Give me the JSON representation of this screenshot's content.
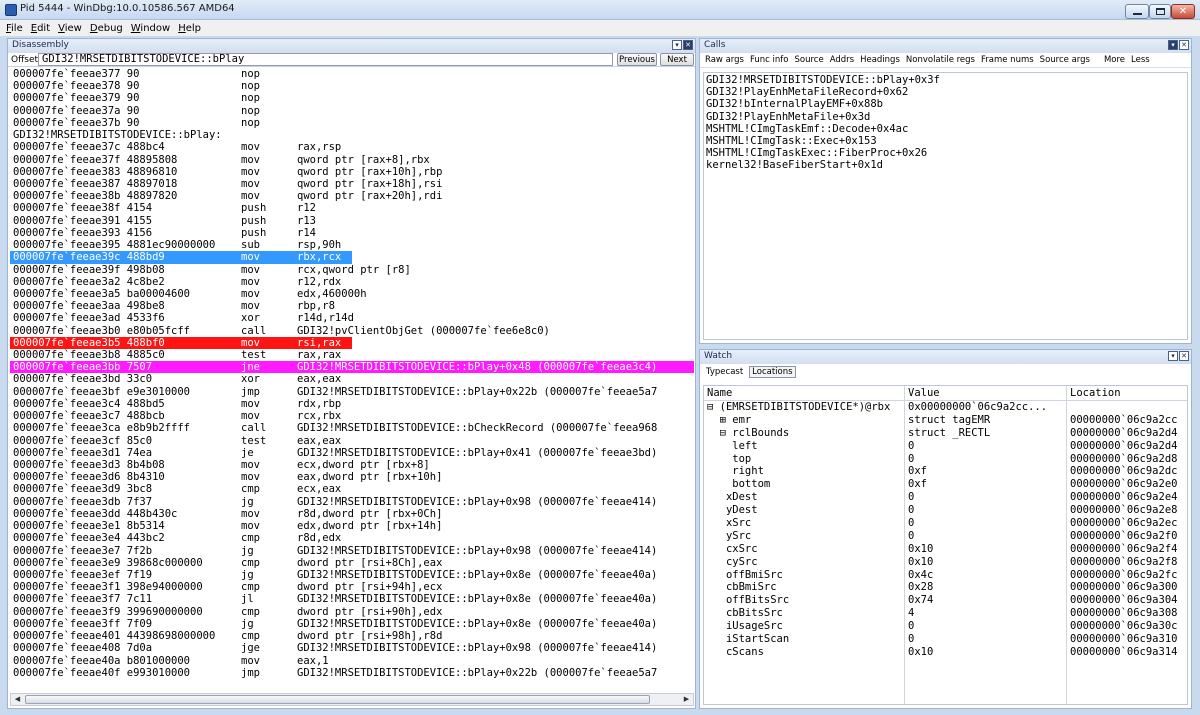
{
  "window": {
    "title": "Pid 5444 - WinDbg:10.0.10586.567 AMD64",
    "minimize": "—",
    "maximize": "□",
    "close": "✕"
  },
  "menu": [
    "File",
    "Edit",
    "View",
    "Debug",
    "Window",
    "Help"
  ],
  "disassembly": {
    "title": "Disassembly",
    "offset_label": "Offset:",
    "offset_value": "GDI32!MRSETDIBITSTODEVICE::bPlay",
    "previous": "Previous",
    "next": "Next",
    "lines": [
      {
        "addr": "000007fe`feeae377 90",
        "mn": "nop",
        "op": ""
      },
      {
        "addr": "000007fe`feeae378 90",
        "mn": "nop",
        "op": ""
      },
      {
        "addr": "000007fe`feeae379 90",
        "mn": "nop",
        "op": ""
      },
      {
        "addr": "000007fe`feeae37a 90",
        "mn": "nop",
        "op": ""
      },
      {
        "addr": "000007fe`feeae37b 90",
        "mn": "nop",
        "op": ""
      },
      {
        "label": "GDI32!MRSETDIBITSTODEVICE::bPlay:"
      },
      {
        "addr": "000007fe`feeae37c 488bc4",
        "mn": "mov",
        "op": "rax,rsp"
      },
      {
        "addr": "000007fe`feeae37f 48895808",
        "mn": "mov",
        "op": "qword ptr [rax+8],rbx"
      },
      {
        "addr": "000007fe`feeae383 48896810",
        "mn": "mov",
        "op": "qword ptr [rax+10h],rbp"
      },
      {
        "addr": "000007fe`feeae387 48897018",
        "mn": "mov",
        "op": "qword ptr [rax+18h],rsi"
      },
      {
        "addr": "000007fe`feeae38b 48897820",
        "mn": "mov",
        "op": "qword ptr [rax+20h],rdi"
      },
      {
        "addr": "000007fe`feeae38f 4154",
        "mn": "push",
        "op": "r12"
      },
      {
        "addr": "000007fe`feeae391 4155",
        "mn": "push",
        "op": "r13"
      },
      {
        "addr": "000007fe`feeae393 4156",
        "mn": "push",
        "op": "r14"
      },
      {
        "addr": "000007fe`feeae395 4881ec90000000",
        "mn": "sub",
        "op": "rsp,90h"
      },
      {
        "addr": "000007fe`feeae39c 488bd9",
        "mn": "mov",
        "op": "rbx,rcx",
        "hl": "blue"
      },
      {
        "addr": "000007fe`feeae39f 498b08",
        "mn": "mov",
        "op": "rcx,qword ptr [r8]"
      },
      {
        "addr": "000007fe`feeae3a2 4c8be2",
        "mn": "mov",
        "op": "r12,rdx"
      },
      {
        "addr": "000007fe`feeae3a5 ba00004600",
        "mn": "mov",
        "op": "edx,460000h"
      },
      {
        "addr": "000007fe`feeae3aa 498be8",
        "mn": "mov",
        "op": "rbp,r8"
      },
      {
        "addr": "000007fe`feeae3ad 4533f6",
        "mn": "xor",
        "op": "r14d,r14d"
      },
      {
        "addr": "000007fe`feeae3b0 e80b05fcff",
        "mn": "call",
        "op": "GDI32!pvClientObjGet (000007fe`fee6e8c0)"
      },
      {
        "addr": "000007fe`feeae3b5 488bf0",
        "mn": "mov",
        "op": "rsi,rax",
        "hl": "red"
      },
      {
        "addr": "000007fe`feeae3b8 4885c0",
        "mn": "test",
        "op": "rax,rax"
      },
      {
        "addr": "000007fe`feeae3bb 7507",
        "mn": "jne",
        "op": "GDI32!MRSETDIBITSTODEVICE::bPlay+0x48 (000007fe`feeae3c4)",
        "hl": "magenta"
      },
      {
        "addr": "000007fe`feeae3bd 33c0",
        "mn": "xor",
        "op": "eax,eax"
      },
      {
        "addr": "000007fe`feeae3bf e9e3010000",
        "mn": "jmp",
        "op": "GDI32!MRSETDIBITSTODEVICE::bPlay+0x22b (000007fe`feeae5a7"
      },
      {
        "addr": "000007fe`feeae3c4 488bd5",
        "mn": "mov",
        "op": "rdx,rbp"
      },
      {
        "addr": "000007fe`feeae3c7 488bcb",
        "mn": "mov",
        "op": "rcx,rbx"
      },
      {
        "addr": "000007fe`feeae3ca e8b9b2ffff",
        "mn": "call",
        "op": "GDI32!MRSETDIBITSTODEVICE::bCheckRecord (000007fe`feea968"
      },
      {
        "addr": "000007fe`feeae3cf 85c0",
        "mn": "test",
        "op": "eax,eax"
      },
      {
        "addr": "000007fe`feeae3d1 74ea",
        "mn": "je",
        "op": "GDI32!MRSETDIBITSTODEVICE::bPlay+0x41 (000007fe`feeae3bd)"
      },
      {
        "addr": "000007fe`feeae3d3 8b4b08",
        "mn": "mov",
        "op": "ecx,dword ptr [rbx+8]"
      },
      {
        "addr": "000007fe`feeae3d6 8b4310",
        "mn": "mov",
        "op": "eax,dword ptr [rbx+10h]"
      },
      {
        "addr": "000007fe`feeae3d9 3bc8",
        "mn": "cmp",
        "op": "ecx,eax"
      },
      {
        "addr": "000007fe`feeae3db 7f37",
        "mn": "jg",
        "op": "GDI32!MRSETDIBITSTODEVICE::bPlay+0x98 (000007fe`feeae414)"
      },
      {
        "addr": "000007fe`feeae3dd 448b430c",
        "mn": "mov",
        "op": "r8d,dword ptr [rbx+0Ch]"
      },
      {
        "addr": "000007fe`feeae3e1 8b5314",
        "mn": "mov",
        "op": "edx,dword ptr [rbx+14h]"
      },
      {
        "addr": "000007fe`feeae3e4 443bc2",
        "mn": "cmp",
        "op": "r8d,edx"
      },
      {
        "addr": "000007fe`feeae3e7 7f2b",
        "mn": "jg",
        "op": "GDI32!MRSETDIBITSTODEVICE::bPlay+0x98 (000007fe`feeae414)"
      },
      {
        "addr": "000007fe`feeae3e9 39868c000000",
        "mn": "cmp",
        "op": "dword ptr [rsi+8Ch],eax"
      },
      {
        "addr": "000007fe`feeae3ef 7f19",
        "mn": "jg",
        "op": "GDI32!MRSETDIBITSTODEVICE::bPlay+0x8e (000007fe`feeae40a)"
      },
      {
        "addr": "000007fe`feeae3f1 398e94000000",
        "mn": "cmp",
        "op": "dword ptr [rsi+94h],ecx"
      },
      {
        "addr": "000007fe`feeae3f7 7c11",
        "mn": "jl",
        "op": "GDI32!MRSETDIBITSTODEVICE::bPlay+0x8e (000007fe`feeae40a)"
      },
      {
        "addr": "000007fe`feeae3f9 399690000000",
        "mn": "cmp",
        "op": "dword ptr [rsi+90h],edx"
      },
      {
        "addr": "000007fe`feeae3ff 7f09",
        "mn": "jg",
        "op": "GDI32!MRSETDIBITSTODEVICE::bPlay+0x8e (000007fe`feeae40a)"
      },
      {
        "addr": "000007fe`feeae401 44398698000000",
        "mn": "cmp",
        "op": "dword ptr [rsi+98h],r8d"
      },
      {
        "addr": "000007fe`feeae408 7d0a",
        "mn": "jge",
        "op": "GDI32!MRSETDIBITSTODEVICE::bPlay+0x98 (000007fe`feeae414)"
      },
      {
        "addr": "000007fe`feeae40a b801000000",
        "mn": "mov",
        "op": "eax,1"
      },
      {
        "addr": "000007fe`feeae40f e993010000",
        "mn": "jmp",
        "op": "GDI32!MRSETDIBITSTODEVICE::bPlay+0x22b (000007fe`feeae5a7"
      }
    ],
    "scroll_grip": "⫼"
  },
  "calls": {
    "title": "Calls",
    "toolbar": [
      "Raw args",
      "Func info",
      "Source",
      "Addrs",
      "Headings",
      "Nonvolatile regs",
      "Frame nums",
      "Source args",
      "More",
      "Less"
    ],
    "frames": [
      "GDI32!MRSETDIBITSTODEVICE::bPlay+0x3f",
      "GDI32!PlayEnhMetaFileRecord+0x62",
      "GDI32!bInternalPlayEMF+0x88b",
      "GDI32!PlayEnhMetaFile+0x3d",
      "MSHTML!CImgTaskEmf::Decode+0x4ac",
      "MSHTML!CImgTask::Exec+0x153",
      "MSHTML!CImgTaskExec::FiberProc+0x26",
      "kernel32!BaseFiberStart+0x1d"
    ]
  },
  "watch": {
    "title": "Watch",
    "tabs": [
      "Typecast",
      "Locations"
    ],
    "headers": {
      "name": "Name",
      "value": "Value",
      "location": "Location"
    },
    "rows": [
      {
        "name": "⊟ (EMRSETDIBITSTODEVICE*)@rbx",
        "value": "0x00000000`06c9a2cc...",
        "location": ""
      },
      {
        "name": "  ⊞ emr",
        "value": "struct tagEMR",
        "location": "00000000`06c9a2cc"
      },
      {
        "name": "  ⊟ rclBounds",
        "value": "struct _RECTL",
        "location": "00000000`06c9a2d4"
      },
      {
        "name": "    left",
        "value": "0",
        "location": "00000000`06c9a2d4"
      },
      {
        "name": "    top",
        "value": "0",
        "location": "00000000`06c9a2d8"
      },
      {
        "name": "    right",
        "value": "0xf",
        "location": "00000000`06c9a2dc"
      },
      {
        "name": "    bottom",
        "value": "0xf",
        "location": "00000000`06c9a2e0"
      },
      {
        "name": "   xDest",
        "value": "0",
        "location": "00000000`06c9a2e4"
      },
      {
        "name": "   yDest",
        "value": "0",
        "location": "00000000`06c9a2e8"
      },
      {
        "name": "   xSrc",
        "value": "0",
        "location": "00000000`06c9a2ec"
      },
      {
        "name": "   ySrc",
        "value": "0",
        "location": "00000000`06c9a2f0"
      },
      {
        "name": "   cxSrc",
        "value": "0x10",
        "location": "00000000`06c9a2f4"
      },
      {
        "name": "   cySrc",
        "value": "0x10",
        "location": "00000000`06c9a2f8"
      },
      {
        "name": "   offBmiSrc",
        "value": "0x4c",
        "location": "00000000`06c9a2fc"
      },
      {
        "name": "   cbBmiSrc",
        "value": "0x28",
        "location": "00000000`06c9a300"
      },
      {
        "name": "   offBitsSrc",
        "value": "0x74",
        "location": "00000000`06c9a304"
      },
      {
        "name": "   cbBitsSrc",
        "value": "4",
        "location": "00000000`06c9a308"
      },
      {
        "name": "   iUsageSrc",
        "value": "0",
        "location": "00000000`06c9a30c"
      },
      {
        "name": "   iStartScan",
        "value": "0",
        "location": "00000000`06c9a310"
      },
      {
        "name": "   cScans",
        "value": "0x10",
        "location": "00000000`06c9a314"
      }
    ]
  },
  "colors": {
    "highlight_blue": "#3399ff",
    "highlight_red": "#ff1414",
    "highlight_magenta": "#ff1aff"
  }
}
